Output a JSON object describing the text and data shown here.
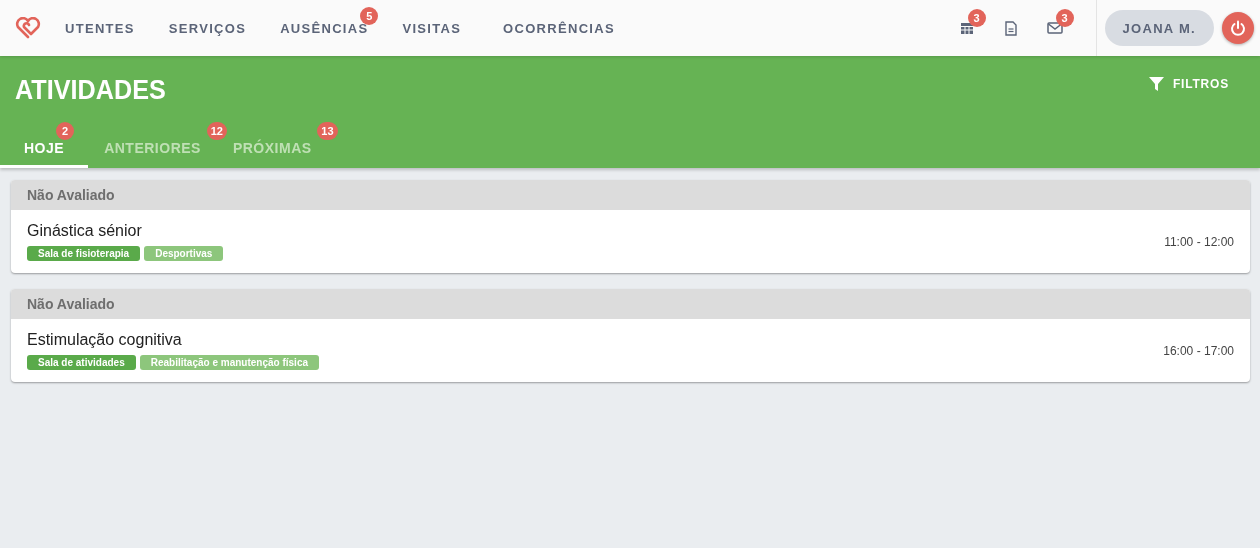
{
  "nav": [
    {
      "label": "UTENTES"
    },
    {
      "label": "SERVIÇOS"
    },
    {
      "label": "AUSÊNCIAS",
      "badge": "5"
    },
    {
      "label": "VISITAS"
    },
    {
      "label": "OCORRÊNCIAS"
    }
  ],
  "toolbar": [
    {
      "kind": "calendar",
      "badge": "3"
    },
    {
      "kind": "document"
    },
    {
      "kind": "mail",
      "badge": "3"
    }
  ],
  "user": {
    "name": "JOANA M."
  },
  "header": {
    "title": "ATIVIDADES",
    "filter_label": "FILTROS"
  },
  "tabs": [
    {
      "label": "HOJE",
      "badge": "2",
      "selected": true
    },
    {
      "label": "ANTERIORES",
      "badge": "12",
      "selected": false
    },
    {
      "label": "PRÓXIMAS",
      "badge": "13",
      "selected": false
    }
  ],
  "activities": [
    {
      "status": "Não Avaliado",
      "title": "Ginástica sénior",
      "time": "11:00 - 12:00",
      "tags": [
        {
          "label": "Sala de fisioterapia",
          "kind": "location"
        },
        {
          "label": "Desportivas",
          "kind": "category"
        }
      ]
    },
    {
      "status": "Não Avaliado",
      "title": "Estimulação cognitiva",
      "time": "16:00 - 17:00",
      "tags": [
        {
          "label": "Sala de atividades",
          "kind": "location"
        },
        {
          "label": "Reabilitação e manutenção física",
          "kind": "category"
        }
      ]
    }
  ]
}
